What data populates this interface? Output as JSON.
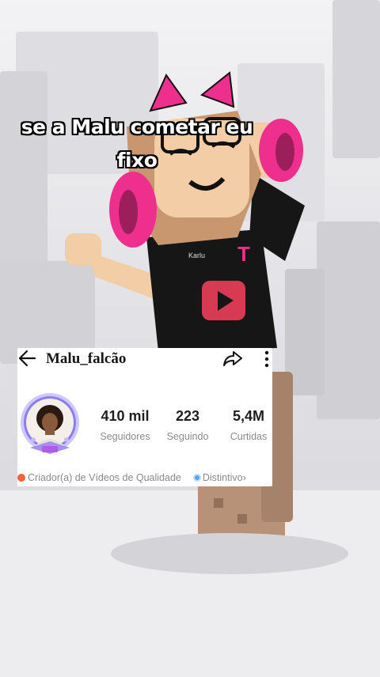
{
  "video": {
    "caption": "se a Malu cometar eu fixo",
    "shirt_text": "Karlu"
  },
  "profile": {
    "username": "Malu_falcão",
    "stats": [
      {
        "value": "410 mil",
        "label": "Seguidores"
      },
      {
        "value": "223",
        "label": "Seguindo"
      },
      {
        "value": "5,4M",
        "label": "Curtidas"
      }
    ],
    "badge_text": "Criador(a) de Vídeos de Qualidade",
    "distinct_label": "Distintivo",
    "distinct_chevron": "›",
    "icons": {
      "back": "back-arrow-icon",
      "share": "share-icon",
      "more": "more-options-icon",
      "badge": "orange-badge-icon",
      "distinct": "blue-badge-icon"
    }
  },
  "colors": {
    "accent_pink": "#ee2f8e",
    "badge_orange": "#f0643a",
    "badge_blue": "#57a7ee",
    "avatar_ring": "#8e7cf3"
  }
}
